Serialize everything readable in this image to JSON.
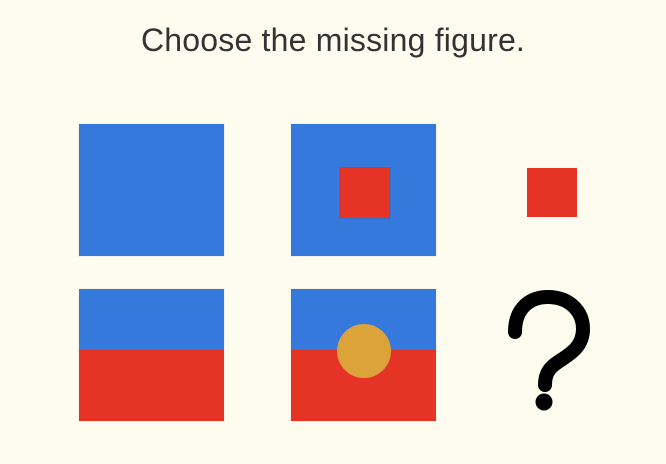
{
  "prompt": {
    "title": "Choose the missing figure."
  },
  "puzzle": {
    "cells": [
      {
        "row": 1,
        "col": 1,
        "content": "blue square"
      },
      {
        "row": 1,
        "col": 2,
        "content": "blue square with red square inside"
      },
      {
        "row": 1,
        "col": 3,
        "content": "red square"
      },
      {
        "row": 2,
        "col": 1,
        "content": "blue and red split rectangle"
      },
      {
        "row": 2,
        "col": 2,
        "content": "blue and red split rectangle with yellow circle"
      },
      {
        "row": 2,
        "col": 3,
        "content": "question mark"
      }
    ],
    "missing_symbol": "?",
    "colors": {
      "background": "#fefcef",
      "blue": "#3579dd",
      "red": "#e53325",
      "yellow": "#dda33b",
      "text": "#333333"
    }
  }
}
